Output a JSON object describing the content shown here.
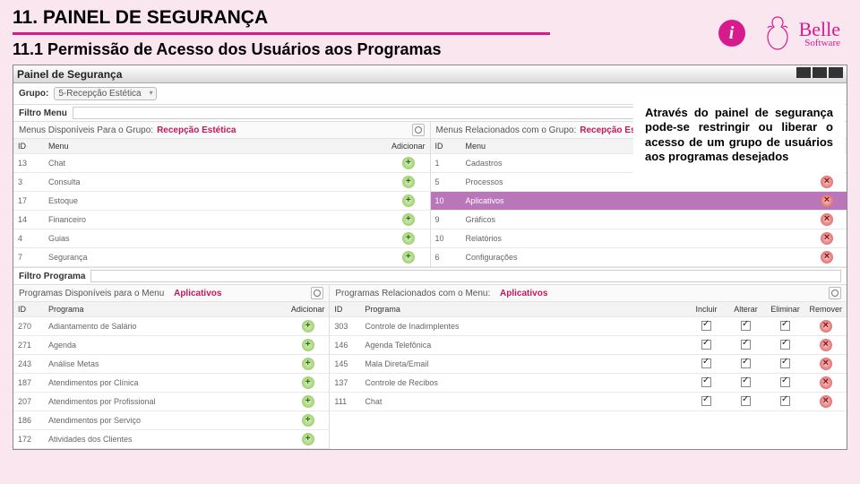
{
  "header": {
    "title": "11. PAINEL DE SEGURANÇA",
    "subtitle": "11.1 Permissão de Acesso dos Usuários aos Programas",
    "logo_brand": "Belle",
    "logo_sub": "Software"
  },
  "note": "Através do painel de segurança pode-se restringir ou liberar o acesso de um grupo de usuários aos programas desejados",
  "win_title": "Painel de Segurança",
  "grupo": {
    "label": "Grupo:",
    "value": "5-Recepção Estética"
  },
  "filtroMenu": {
    "label": "Filtro Menu"
  },
  "filtroPrograma": {
    "label": "Filtro Programa"
  },
  "pane_left_menu": {
    "title": "Menus Disponíveis Para o Grupo:",
    "em": "Recepção Estética",
    "cols": {
      "id": "ID",
      "menu": "Menu",
      "add": "Adicionar"
    },
    "rows": [
      {
        "id": "13",
        "menu": "Chat"
      },
      {
        "id": "3",
        "menu": "Consulta"
      },
      {
        "id": "17",
        "menu": "Estoque"
      },
      {
        "id": "14",
        "menu": "Financeiro"
      },
      {
        "id": "4",
        "menu": "Guias"
      },
      {
        "id": "7",
        "menu": "Segurança"
      }
    ]
  },
  "pane_right_menu": {
    "title": "Menus Relacionados com o Grupo:",
    "em": "Recepção Estética",
    "cols": {
      "id": "ID",
      "menu": "Menu"
    },
    "rows": [
      {
        "id": "1",
        "menu": "Cadastros"
      },
      {
        "id": "5",
        "menu": "Processos"
      },
      {
        "id": "10",
        "menu": "Aplicativos",
        "sel": true
      },
      {
        "id": "9",
        "menu": "Gráficos"
      },
      {
        "id": "10",
        "menu": "Relatórios"
      },
      {
        "id": "6",
        "menu": "Configurações"
      }
    ]
  },
  "pane_left_prog": {
    "title": "Programas Disponíveis para o Menu",
    "em": "Aplicativos",
    "cols": {
      "id": "ID",
      "prog": "Programa",
      "add": "Adicionar"
    },
    "rows": [
      {
        "id": "270",
        "prog": "Adiantamento de Salário"
      },
      {
        "id": "271",
        "prog": "Agenda"
      },
      {
        "id": "243",
        "prog": "Análise Metas"
      },
      {
        "id": "187",
        "prog": "Atendimentos por Clínica"
      },
      {
        "id": "207",
        "prog": "Atendimentos por Profissional"
      },
      {
        "id": "186",
        "prog": "Atendimentos por Serviço"
      },
      {
        "id": "172",
        "prog": "Atividades dos Clientes"
      }
    ]
  },
  "pane_right_prog": {
    "title": "Programas Relacionados com o Menu:",
    "em": "Aplicativos",
    "cols": {
      "id": "ID",
      "prog": "Programa",
      "inc": "Incluir",
      "alt": "Alterar",
      "eli": "Eliminar",
      "rem": "Remover"
    },
    "rows": [
      {
        "id": "303",
        "prog": "Controle de Inadimplentes"
      },
      {
        "id": "146",
        "prog": "Agenda Telefônica"
      },
      {
        "id": "145",
        "prog": "Mala Direta/Email"
      },
      {
        "id": "137",
        "prog": "Controle de Recibos"
      },
      {
        "id": "111",
        "prog": "Chat"
      }
    ]
  }
}
